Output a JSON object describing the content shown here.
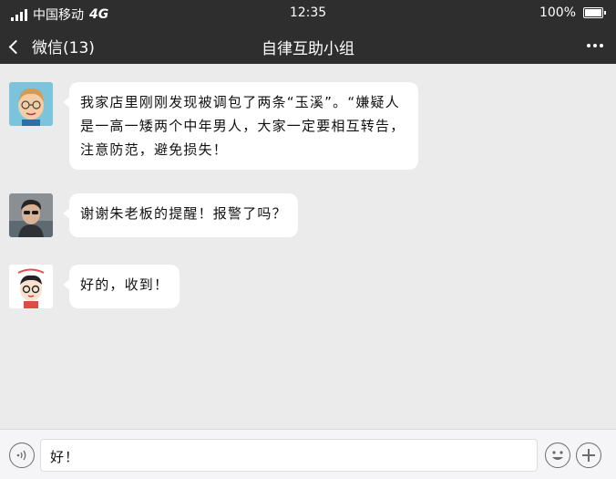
{
  "status_bar": {
    "carrier": "中国移动",
    "network": "4G",
    "time": "12:35",
    "battery": "100%"
  },
  "nav": {
    "back_label": "微信(13)",
    "title": "自律互助小组"
  },
  "messages": [
    {
      "avatar": "elder-man-cartoon-avatar",
      "text": "我家店里刚刚发现被调包了两条“玉溪”。“嫌疑人是一高一矮两个中年男人，大家一定要相互转告，注意防范，避免损失！"
    },
    {
      "avatar": "man-sunglasses-photo-avatar",
      "text": "谢谢朱老板的提醒！报警了吗？"
    },
    {
      "avatar": "cartoon-boy-avatar",
      "text": "好的，收到！"
    }
  ],
  "input_bar": {
    "value": "好！",
    "icons": [
      "voice-icon",
      "emoji-icon",
      "plus-icon"
    ]
  },
  "colors": {
    "bar": "#2e2e2e",
    "chat_bg": "#ebebeb",
    "bubble": "#ffffff"
  }
}
